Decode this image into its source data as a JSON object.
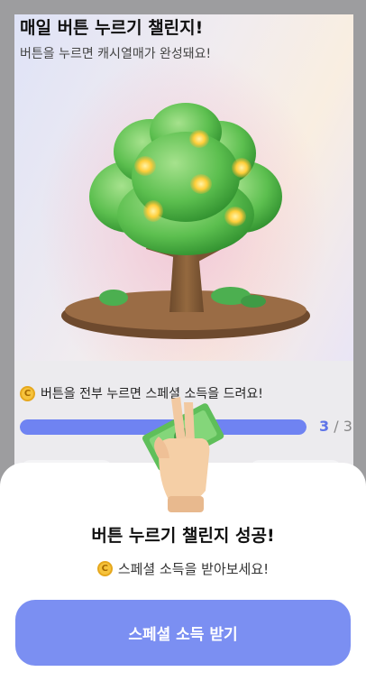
{
  "header": {
    "title": "매일 버튼 누르기 챌린지!",
    "subtitle": "버튼을 누르면 캐시열매가 완성돼요!"
  },
  "hero": {
    "image": "money-tree-with-coins"
  },
  "progress": {
    "coin_icon": "C",
    "message": "버튼을 전부 누르면 스페셜 소득을 드려요!",
    "current": "3",
    "total_label": "/ 3",
    "fraction": 1.0
  },
  "sheet": {
    "title": "버튼 누르기 챌린지 성공!",
    "coin_icon": "C",
    "subtitle": "스페셜 소득을 받아보세요!",
    "button_label": "스페셜 소득 받기",
    "illustration": "hand-holding-money-icon"
  },
  "colors": {
    "accent": "#6f83f2",
    "button": "#7b8ff2",
    "coin": "#f6c33c",
    "progress_track": "#cfd3f2"
  }
}
